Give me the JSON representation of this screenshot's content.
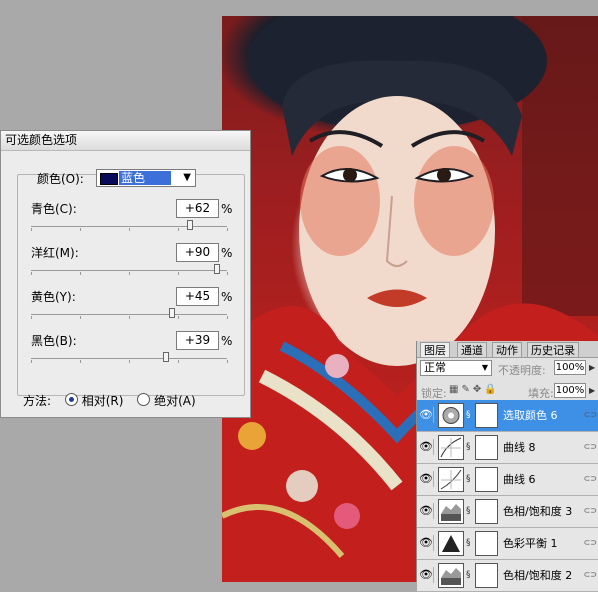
{
  "dialog": {
    "title": "可选颜色选项",
    "color_label": "颜色(O):",
    "color_value": "蓝色",
    "swatch_color": "#0a0a5a",
    "sliders": [
      {
        "label": "青色(C):",
        "value": "+62",
        "unit": "%",
        "fraction": 0.81
      },
      {
        "label": "洋红(M):",
        "value": "+90",
        "unit": "%",
        "fraction": 0.95
      },
      {
        "label": "黄色(Y):",
        "value": "+45",
        "unit": "%",
        "fraction": 0.72
      },
      {
        "label": "黑色(B):",
        "value": "+39",
        "unit": "%",
        "fraction": 0.69
      }
    ],
    "method_label": "方法:",
    "method_relative": "相对(R)",
    "method_absolute": "绝对(A)"
  },
  "layers_panel": {
    "tabs": [
      "图层",
      "通道",
      "动作",
      "历史记录"
    ],
    "blend_mode": "正常",
    "opacity_label": "不透明度:",
    "opacity_value": "100%",
    "lock_label": "锁定:",
    "fill_label": "填充:",
    "fill_value": "100%",
    "layers": [
      {
        "name": "选取颜色 6",
        "icon": "selective-color-icon",
        "selected": true
      },
      {
        "name": "曲线 8",
        "icon": "curves-icon",
        "selected": false
      },
      {
        "name": "曲线 6",
        "icon": "curves-icon",
        "selected": false
      },
      {
        "name": "色相/饱和度 3",
        "icon": "hue-saturation-icon",
        "selected": false
      },
      {
        "name": "色彩平衡 1",
        "icon": "color-balance-icon",
        "selected": false
      },
      {
        "name": "色相/饱和度 2",
        "icon": "hue-saturation-icon",
        "selected": false
      }
    ]
  }
}
